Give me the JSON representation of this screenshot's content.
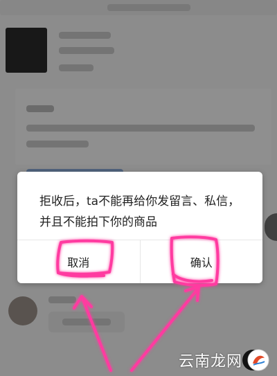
{
  "dialog": {
    "message": "拒收后，ta不能再给你发留言、私信，并且不能拍下你的商品",
    "cancel_label": "取消",
    "confirm_label": "确认"
  },
  "watermark": {
    "text": "云南龙网"
  },
  "colors": {
    "overlay": "#000000",
    "annotation": "#ff3aa0",
    "dialog_bg": "#ffffff"
  },
  "icons": {
    "avatar": "avatar-icon",
    "watermark_logo": "watermark-logo-icon"
  }
}
